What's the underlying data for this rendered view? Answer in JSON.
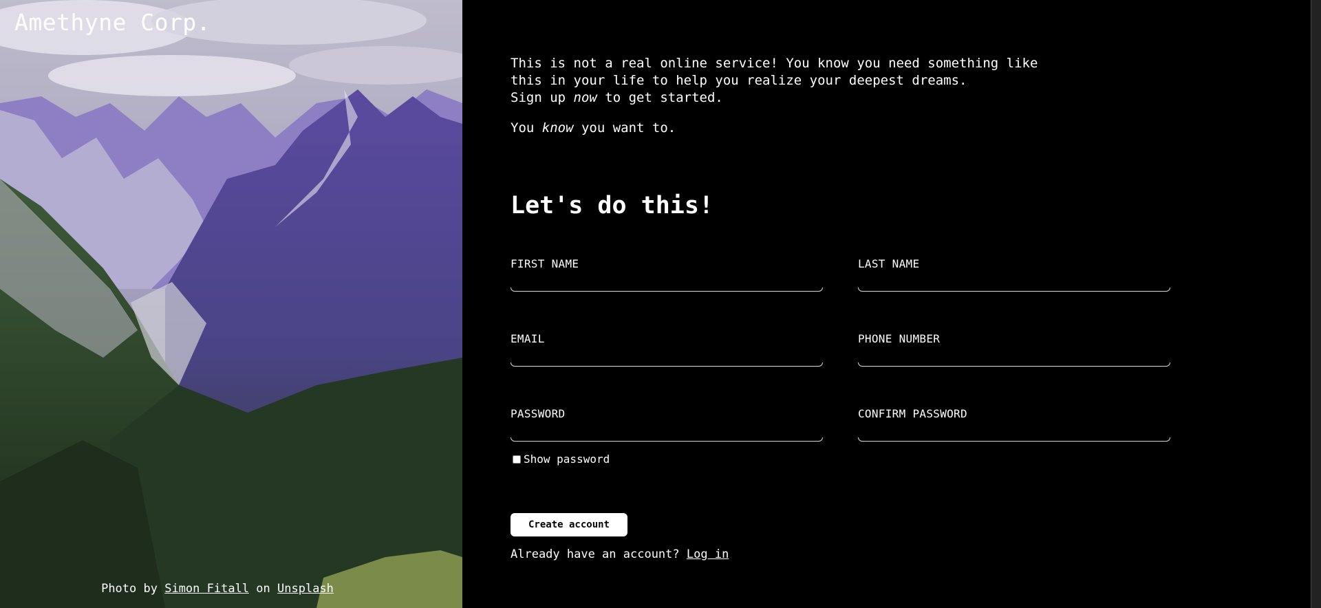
{
  "brand": {
    "name": "Amethyne Corp."
  },
  "hero_credit": {
    "prefix": "Photo by",
    "author": "Simon Fitall",
    "middle": "on",
    "source": "Unsplash"
  },
  "intro": {
    "line1": "This is not a real online service! You know you need something like",
    "line2": "this in your life to help you realize your deepest dreams.",
    "line3_before": "Sign up ",
    "line3_em": "now",
    "line3_after": " to get started.",
    "p2_before": "You ",
    "p2_em": "know",
    "p2_after": " you want to."
  },
  "form": {
    "heading": "Let's do this!",
    "first_name_label": "FIRST NAME",
    "last_name_label": "LAST NAME",
    "email_label": "EMAIL",
    "phone_label": "PHONE NUMBER",
    "password_label": "PASSWORD",
    "confirm_password_label": "CONFIRM PASSWORD",
    "first_name_value": "",
    "last_name_value": "",
    "email_value": "",
    "phone_value": "",
    "password_value": "",
    "confirm_password_value": "",
    "show_password_label": "Show password",
    "show_password_checked": false,
    "submit_label": "Create account",
    "login_prompt": "Already have an account?",
    "login_link": "Log in"
  },
  "colors": {
    "background": "#000000",
    "text": "#ffffff",
    "button_bg": "#ffffff",
    "button_text": "#000000"
  }
}
